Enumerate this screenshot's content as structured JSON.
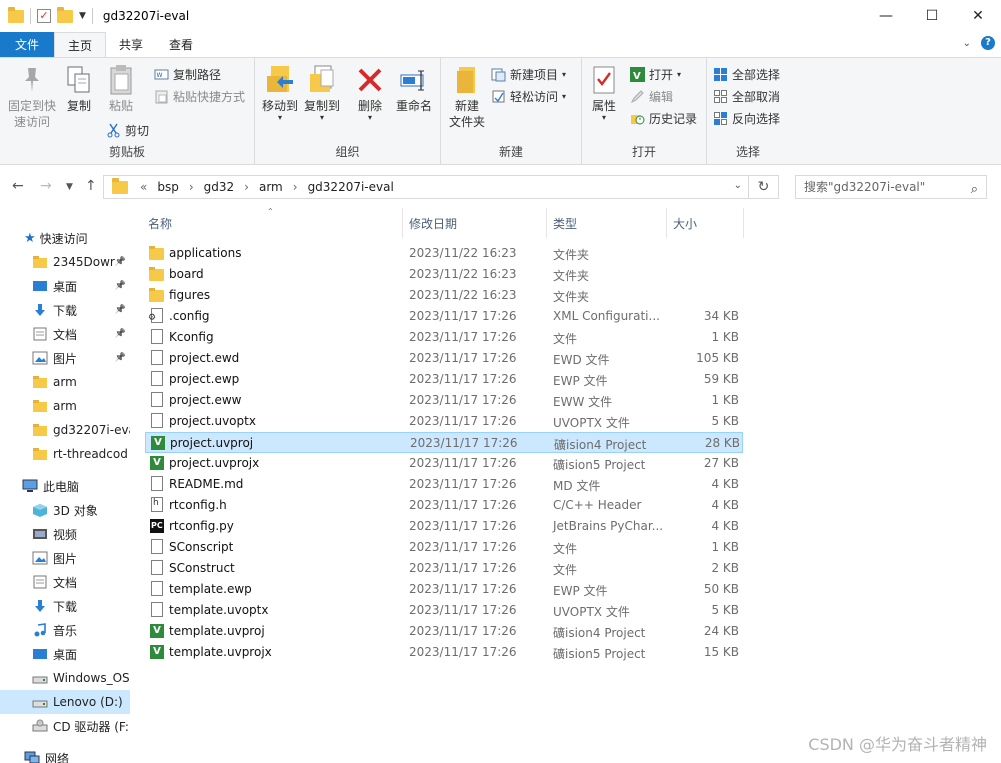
{
  "window": {
    "title": "gd32207i-eval",
    "controls": {
      "minimize": "—",
      "maximize": "☐",
      "close": "✕"
    }
  },
  "ribbon_tabs": {
    "file": "文件",
    "home": "主页",
    "share": "共享",
    "view": "查看"
  },
  "ribbon": {
    "clipboard": {
      "label": "剪贴板",
      "pin": "固定到快\n速访问",
      "copy": "复制",
      "paste": "粘贴",
      "copy_path": "复制路径",
      "paste_shortcut": "粘贴快捷方式",
      "cut": "剪切"
    },
    "organize": {
      "label": "组织",
      "move_to": "移动到",
      "copy_to": "复制到",
      "delete": "删除",
      "rename": "重命名"
    },
    "new": {
      "label": "新建",
      "new_folder": "新建\n文件夹",
      "new_item": "新建项目",
      "easy_access": "轻松访问"
    },
    "open": {
      "label": "打开",
      "properties": "属性",
      "open": "打开",
      "edit": "编辑",
      "history": "历史记录"
    },
    "select": {
      "label": "选择",
      "select_all": "全部选择",
      "select_none": "全部取消",
      "invert": "反向选择"
    }
  },
  "address": {
    "overflow": "«",
    "crumbs": [
      "bsp",
      "gd32",
      "arm",
      "gd32207i-eval"
    ],
    "separator": "›",
    "search_placeholder": "搜索\"gd32207i-eval\""
  },
  "nav": {
    "quick_access": "快速访问",
    "items": [
      {
        "label": "2345Dowr",
        "icon": "folder-icon",
        "pinned": true
      },
      {
        "label": "桌面",
        "icon": "desktop-icon",
        "pinned": true
      },
      {
        "label": "下载",
        "icon": "download-icon",
        "pinned": true
      },
      {
        "label": "文档",
        "icon": "document-icon",
        "pinned": true
      },
      {
        "label": "图片",
        "icon": "picture-icon",
        "pinned": true
      },
      {
        "label": "arm",
        "icon": "folder-icon",
        "pinned": false
      },
      {
        "label": "arm",
        "icon": "folder-icon",
        "pinned": false
      },
      {
        "label": "gd32207i-eva",
        "icon": "folder-icon",
        "pinned": false
      },
      {
        "label": "rt-threadcod",
        "icon": "folder-icon",
        "pinned": false
      }
    ],
    "this_pc": "此电脑",
    "pc_items": [
      {
        "label": "3D 对象",
        "icon": "3d-objects-icon"
      },
      {
        "label": "视频",
        "icon": "video-icon"
      },
      {
        "label": "图片",
        "icon": "picture-icon"
      },
      {
        "label": "文档",
        "icon": "document-icon"
      },
      {
        "label": "下载",
        "icon": "download-icon"
      },
      {
        "label": "音乐",
        "icon": "music-icon"
      },
      {
        "label": "桌面",
        "icon": "desktop-icon"
      },
      {
        "label": "Windows_OS",
        "icon": "drive-icon"
      },
      {
        "label": "Lenovo (D:)",
        "icon": "drive-icon"
      },
      {
        "label": "CD 驱动器 (F:",
        "icon": "cd-drive-icon"
      }
    ],
    "network": "网络"
  },
  "columns": {
    "name": "名称",
    "date": "修改日期",
    "type": "类型",
    "size": "大小"
  },
  "files": [
    {
      "name": "applications",
      "date": "2023/11/22 16:23",
      "type": "文件夹",
      "size": "",
      "icon": "folder"
    },
    {
      "name": "board",
      "date": "2023/11/22 16:23",
      "type": "文件夹",
      "size": "",
      "icon": "folder"
    },
    {
      "name": "figures",
      "date": "2023/11/22 16:23",
      "type": "文件夹",
      "size": "",
      "icon": "folder"
    },
    {
      "name": ".config",
      "date": "2023/11/17 17:26",
      "type": "XML Configurati...",
      "size": "34 KB",
      "icon": "config"
    },
    {
      "name": "Kconfig",
      "date": "2023/11/17 17:26",
      "type": "文件",
      "size": "1 KB",
      "icon": "doc"
    },
    {
      "name": "project.ewd",
      "date": "2023/11/17 17:26",
      "type": "EWD 文件",
      "size": "105 KB",
      "icon": "doc"
    },
    {
      "name": "project.ewp",
      "date": "2023/11/17 17:26",
      "type": "EWP 文件",
      "size": "59 KB",
      "icon": "doc"
    },
    {
      "name": "project.eww",
      "date": "2023/11/17 17:26",
      "type": "EWW 文件",
      "size": "1 KB",
      "icon": "doc"
    },
    {
      "name": "project.uvoptx",
      "date": "2023/11/17 17:26",
      "type": "UVOPTX 文件",
      "size": "5 KB",
      "icon": "doc"
    },
    {
      "name": "project.uvproj",
      "date": "2023/11/17 17:26",
      "type": "礦ision4 Project",
      "size": "28 KB",
      "icon": "uv",
      "selected": true
    },
    {
      "name": "project.uvprojx",
      "date": "2023/11/17 17:26",
      "type": "礦ision5 Project",
      "size": "27 KB",
      "icon": "uv"
    },
    {
      "name": "README.md",
      "date": "2023/11/17 17:26",
      "type": "MD 文件",
      "size": "4 KB",
      "icon": "doc"
    },
    {
      "name": "rtconfig.h",
      "date": "2023/11/17 17:26",
      "type": "C/C++ Header",
      "size": "4 KB",
      "icon": "header"
    },
    {
      "name": "rtconfig.py",
      "date": "2023/11/17 17:26",
      "type": "JetBrains PyChar...",
      "size": "4 KB",
      "icon": "py"
    },
    {
      "name": "SConscript",
      "date": "2023/11/17 17:26",
      "type": "文件",
      "size": "1 KB",
      "icon": "doc"
    },
    {
      "name": "SConstruct",
      "date": "2023/11/17 17:26",
      "type": "文件",
      "size": "2 KB",
      "icon": "doc"
    },
    {
      "name": "template.ewp",
      "date": "2023/11/17 17:26",
      "type": "EWP 文件",
      "size": "50 KB",
      "icon": "doc"
    },
    {
      "name": "template.uvoptx",
      "date": "2023/11/17 17:26",
      "type": "UVOPTX 文件",
      "size": "5 KB",
      "icon": "doc"
    },
    {
      "name": "template.uvproj",
      "date": "2023/11/17 17:26",
      "type": "礦ision4 Project",
      "size": "24 KB",
      "icon": "uv"
    },
    {
      "name": "template.uvprojx",
      "date": "2023/11/17 17:26",
      "type": "礦ision5 Project",
      "size": "15 KB",
      "icon": "uv"
    }
  ],
  "watermark": "CSDN @华为奋斗者精神",
  "colors": {
    "accent": "#1979ca",
    "selection": "#cce8ff",
    "folder": "#f7c948"
  }
}
